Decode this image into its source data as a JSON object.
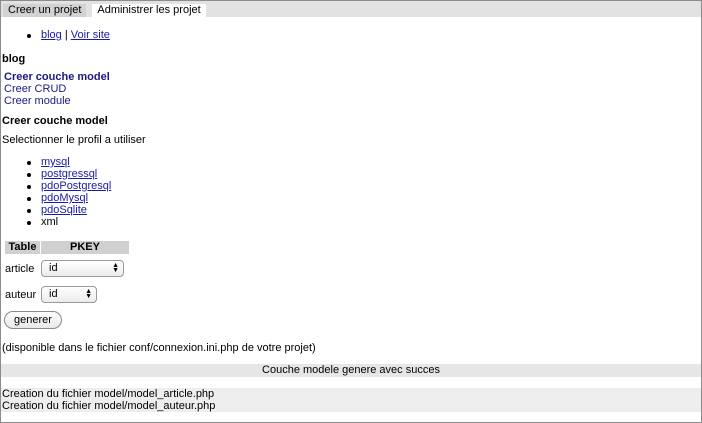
{
  "tabs": [
    {
      "label": "Creer un projet",
      "active": false
    },
    {
      "label": "Administrer les projet",
      "active": true
    }
  ],
  "nav": {
    "blog_link": "blog",
    "separator": "|",
    "site_link": "Voir site"
  },
  "project_heading": "blog",
  "menu": {
    "items": [
      "Creer couche model",
      "Creer CRUD",
      "Creer module"
    ],
    "selected": "Creer couche model"
  },
  "section_heading": "Creer couche model",
  "profile_prompt": "Selectionner le profil a utiliser",
  "profiles": [
    {
      "label": "mysql",
      "link": true
    },
    {
      "label": "postgressql",
      "link": true
    },
    {
      "label": "pdoPostgresql",
      "link": true
    },
    {
      "label": "pdoMysql",
      "link": true
    },
    {
      "label": "pdoSqlite",
      "link": true
    },
    {
      "label": "xml",
      "link": false
    }
  ],
  "pkey_table": {
    "headers": [
      "Table",
      "PKEY"
    ],
    "rows": [
      {
        "table": "article",
        "pkey": "id"
      },
      {
        "table": "auteur",
        "pkey": "id"
      }
    ]
  },
  "generate_button": "generer",
  "note": "(disponible dans le fichier conf/connexion.ini.php de votre projet)",
  "success_message": "Couche modele genere avec succes",
  "log": [
    "Creation du fichier model/model_article.php",
    "Creation du fichier model/model_auteur.php"
  ]
}
